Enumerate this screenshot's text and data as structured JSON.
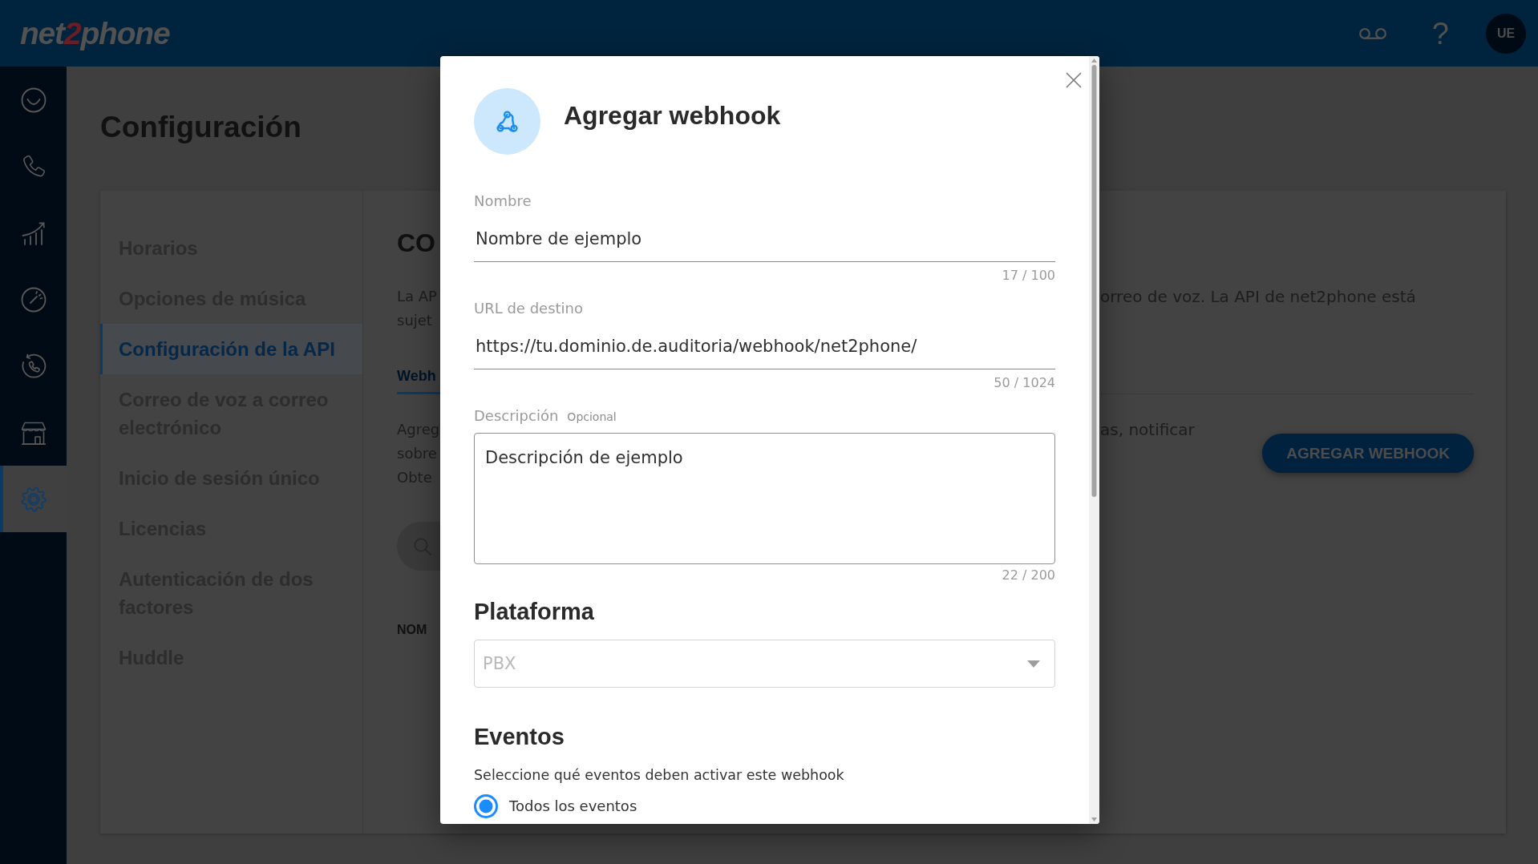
{
  "header": {
    "logo": [
      {
        "text": "net",
        "color": "#525252"
      },
      {
        "text": "2",
        "color": "#6b1d24"
      },
      {
        "text": "phone",
        "color": "#525252"
      }
    ],
    "help": "?",
    "avatar": "UE"
  },
  "rail": [
    {
      "kind": "smile",
      "selected": false
    },
    {
      "kind": "phone",
      "selected": false
    },
    {
      "kind": "chart",
      "selected": false
    },
    {
      "kind": "gauge",
      "selected": false
    },
    {
      "kind": "call_history",
      "selected": false
    },
    {
      "kind": "store",
      "selected": false
    },
    {
      "kind": "settings",
      "selected": true
    }
  ],
  "page": {
    "title": "Configuración"
  },
  "settings_nav": [
    {
      "label": "Horarios",
      "selected": false
    },
    {
      "label": "Opciones de música",
      "selected": false
    },
    {
      "label": "Configuración de la API",
      "selected": true
    },
    {
      "label": "Correo de voz a correo electrónico",
      "selected": false
    },
    {
      "label": "Inicio de sesión único",
      "selected": false
    },
    {
      "label": "Licencias",
      "selected": false
    },
    {
      "label": "Autenticación de dos factores",
      "selected": false
    },
    {
      "label": "Huddle",
      "selected": false
    }
  ],
  "content": {
    "heading": "CO",
    "intro_fragments": [
      "La AP",
      "sujet"
    ],
    "intro_continuation": "orreo de voz. La API de net2phone está",
    "tab": {
      "label": "Webh",
      "selected": true
    },
    "description_fragments": [
      "Agreg",
      "sobre",
      "Obte"
    ],
    "description_continuation": "as, notificar",
    "add_button": "AGREGAR WEBHOOK",
    "column_1": "NOM"
  },
  "dialog": {
    "title": "Agregar webhook",
    "fields": [
      {
        "kind": "text",
        "label": "Nombre",
        "value": "Nombre de ejemplo",
        "counter": "17 / 100"
      },
      {
        "kind": "text",
        "label": "URL de destino",
        "value": "https://tu.dominio.de.auditoria/webhook/net2phone/",
        "counter": "50 / 1024"
      },
      {
        "kind": "textarea",
        "label": "Descripción",
        "optional": "Opcional",
        "value": "Descripción de ejemplo",
        "counter": "22 / 200"
      }
    ],
    "platform": {
      "heading": "Plataforma",
      "value": "PBX",
      "disabled": true
    },
    "events": {
      "heading": "Eventos",
      "instruction": "Seleccione qué eventos deben activar este webhook",
      "options": [
        {
          "label": "Todos los eventos",
          "selected": true
        }
      ]
    }
  }
}
